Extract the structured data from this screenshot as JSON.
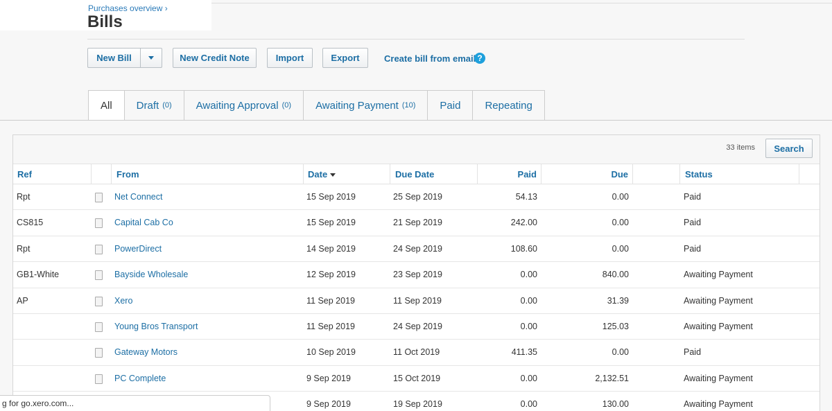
{
  "breadcrumb": "Purchases overview ›",
  "page_title": "Bills",
  "toolbar": {
    "new_bill": "New Bill",
    "new_credit_note": "New Credit Note",
    "import": "Import",
    "export": "Export",
    "create_from_email": "Create bill from email",
    "help": "?"
  },
  "tabs": [
    {
      "label": "All",
      "count": ""
    },
    {
      "label": "Draft",
      "count": "(0)"
    },
    {
      "label": "Awaiting Approval",
      "count": "(0)"
    },
    {
      "label": "Awaiting Payment",
      "count": "(10)"
    },
    {
      "label": "Paid",
      "count": ""
    },
    {
      "label": "Repeating",
      "count": ""
    }
  ],
  "list": {
    "items_count": "33 items",
    "search_label": "Search",
    "columns": {
      "ref": "Ref",
      "from": "From",
      "date": "Date",
      "due_date": "Due Date",
      "paid": "Paid",
      "due": "Due",
      "status": "Status"
    },
    "rows": [
      {
        "ref": "Rpt",
        "from": "Net Connect",
        "date": "15 Sep 2019",
        "due_date": "25 Sep 2019",
        "paid": "54.13",
        "due": "0.00",
        "status": "Paid"
      },
      {
        "ref": "CS815",
        "from": "Capital Cab Co",
        "date": "15 Sep 2019",
        "due_date": "21 Sep 2019",
        "paid": "242.00",
        "due": "0.00",
        "status": "Paid"
      },
      {
        "ref": "Rpt",
        "from": "PowerDirect",
        "date": "14 Sep 2019",
        "due_date": "24 Sep 2019",
        "paid": "108.60",
        "due": "0.00",
        "status": "Paid"
      },
      {
        "ref": "GB1-White",
        "from": "Bayside Wholesale",
        "date": "12 Sep 2019",
        "due_date": "23 Sep 2019",
        "paid": "0.00",
        "due": "840.00",
        "status": "Awaiting Payment"
      },
      {
        "ref": "AP",
        "from": "Xero",
        "date": "11 Sep 2019",
        "due_date": "11 Sep 2019",
        "paid": "0.00",
        "due": "31.39",
        "status": "Awaiting Payment"
      },
      {
        "ref": "",
        "from": "Young Bros Transport",
        "date": "11 Sep 2019",
        "due_date": "24 Sep 2019",
        "paid": "0.00",
        "due": "125.03",
        "status": "Awaiting Payment"
      },
      {
        "ref": "",
        "from": "Gateway Motors",
        "date": "10 Sep 2019",
        "due_date": "11 Oct 2019",
        "paid": "411.35",
        "due": "0.00",
        "status": "Paid"
      },
      {
        "ref": "",
        "from": "PC Complete",
        "date": "9 Sep 2019",
        "due_date": "15 Oct 2019",
        "paid": "0.00",
        "due": "2,132.51",
        "status": "Awaiting Payment"
      },
      {
        "ref": "",
        "from": "",
        "date": "9 Sep 2019",
        "due_date": "19 Sep 2019",
        "paid": "0.00",
        "due": "130.00",
        "status": "Awaiting Payment"
      }
    ]
  },
  "statusbar": "g for go.xero.com..."
}
